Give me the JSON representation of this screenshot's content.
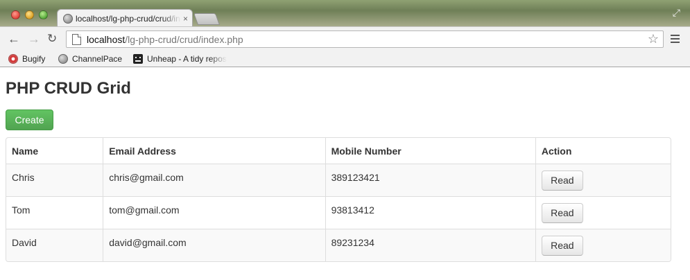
{
  "browser": {
    "tab_title": "localhost/lg-php-crud/crud/index.php",
    "tab_close": "×",
    "url_host": "localhost",
    "url_path": "/lg-php-crud/crud/index.php",
    "icons": {
      "back": "←",
      "forward": "→",
      "reload": "↻",
      "star": "☆",
      "fullscreen": "⤢"
    },
    "bookmarks": [
      {
        "label": "Bugify",
        "icon": "bugify-icon"
      },
      {
        "label": "ChannelPace",
        "icon": "globe-icon"
      },
      {
        "label": "Unheap - A tidy repository of jQuery plugins",
        "icon": "unheap-icon"
      }
    ]
  },
  "page": {
    "title": "PHP CRUD Grid",
    "create_label": "Create",
    "accent_color": "#5cb85c",
    "table": {
      "headers": [
        "Name",
        "Email Address",
        "Mobile Number",
        "Action"
      ],
      "rows": [
        {
          "name": "Chris",
          "email": "chris@gmail.com",
          "mobile": "389123421",
          "action": "Read"
        },
        {
          "name": "Tom",
          "email": "tom@gmail.com",
          "mobile": "93813412",
          "action": "Read"
        },
        {
          "name": "David",
          "email": "david@gmail.com",
          "mobile": "89231234",
          "action": "Read"
        }
      ]
    }
  }
}
